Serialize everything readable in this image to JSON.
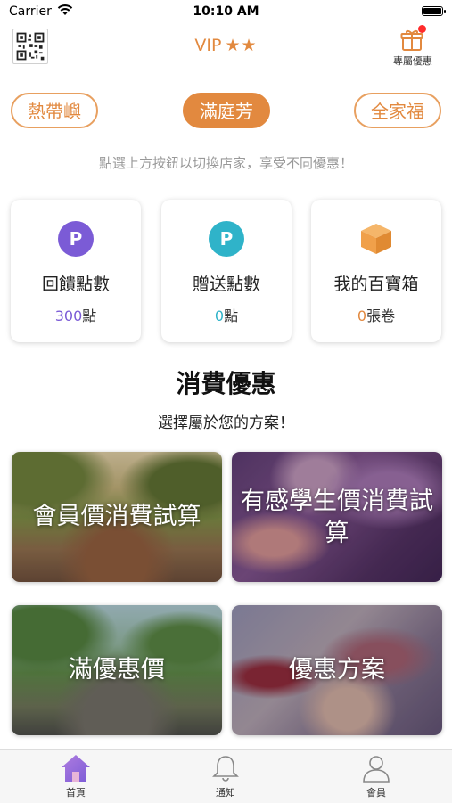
{
  "status_bar": {
    "carrier": "Carrier",
    "time": "10:10 AM"
  },
  "header": {
    "vip_label": "VIP",
    "vip_stars": "★★",
    "gift_label": "專屬優惠"
  },
  "stores": [
    {
      "label": "熱帶嶼",
      "active": false
    },
    {
      "label": "滿庭芳",
      "active": true
    },
    {
      "label": "全家福",
      "active": false
    }
  ],
  "hint": "點選上方按鈕以切換店家，享受不同優惠！",
  "cards": [
    {
      "icon": "points-p-icon",
      "icon_text": "P",
      "icon_color": "#7b5bd6",
      "title": "回饋點數",
      "value": "300",
      "unit": "點",
      "value_color": "#7b5bd6"
    },
    {
      "icon": "gift-points-p-icon",
      "icon_text": "P",
      "icon_color": "#2fb3c9",
      "title": "贈送點數",
      "value": "0",
      "unit": "點",
      "value_color": "#2fb3c9"
    },
    {
      "icon": "treasure-box-icon",
      "icon_text": "",
      "icon_color": "#f0a04a",
      "title": "我的百寶箱",
      "value": "0",
      "unit": "張卷",
      "value_color": "#e2893f"
    }
  ],
  "section": {
    "title": "消費優惠",
    "subtitle": "選擇屬於您的方案！"
  },
  "tiles": [
    {
      "label": "會員價消費試算"
    },
    {
      "label": "有感學生價消費試算"
    },
    {
      "label": "滿優惠價"
    },
    {
      "label": "優惠方案"
    }
  ],
  "tabbar": {
    "home": "首頁",
    "notify": "通知",
    "member": "會員"
  },
  "colors": {
    "accent": "#e2893f",
    "purple": "#7b5bd6",
    "teal": "#2fb3c9"
  }
}
